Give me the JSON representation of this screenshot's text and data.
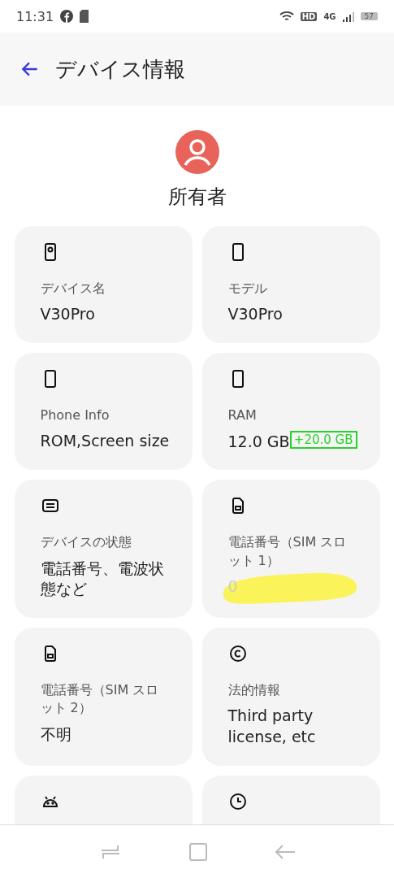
{
  "status_bar": {
    "time": "11:31",
    "network": "HD",
    "network_type": "4G",
    "battery": "57"
  },
  "header": {
    "title": "デバイス情報"
  },
  "owner": {
    "label": "所有者"
  },
  "cards": [
    {
      "kind": "full",
      "label": "デバイス名",
      "value": "V30Pro"
    },
    {
      "kind": "full",
      "label": "モデル",
      "value": "V30Pro"
    },
    {
      "kind": "full",
      "label": "Phone Info",
      "value": "ROM,Screen size"
    },
    {
      "kind": "full",
      "label": "RAM",
      "value": "12.0 GB",
      "badge": "+20.0 GB"
    },
    {
      "kind": "full",
      "label": "デバイスの状態",
      "value": "電話番号、電波状態など"
    },
    {
      "kind": "full",
      "label": "電話番号（SIM スロット 1）",
      "value": "0",
      "redacted": true
    },
    {
      "kind": "full",
      "label": "電話番号（SIM スロット 2）",
      "value": "不明"
    },
    {
      "kind": "full",
      "label": "法的情報",
      "value": "Third party license, etc"
    },
    {
      "kind": "cut_off"
    },
    {
      "kind": "cut_off"
    }
  ]
}
